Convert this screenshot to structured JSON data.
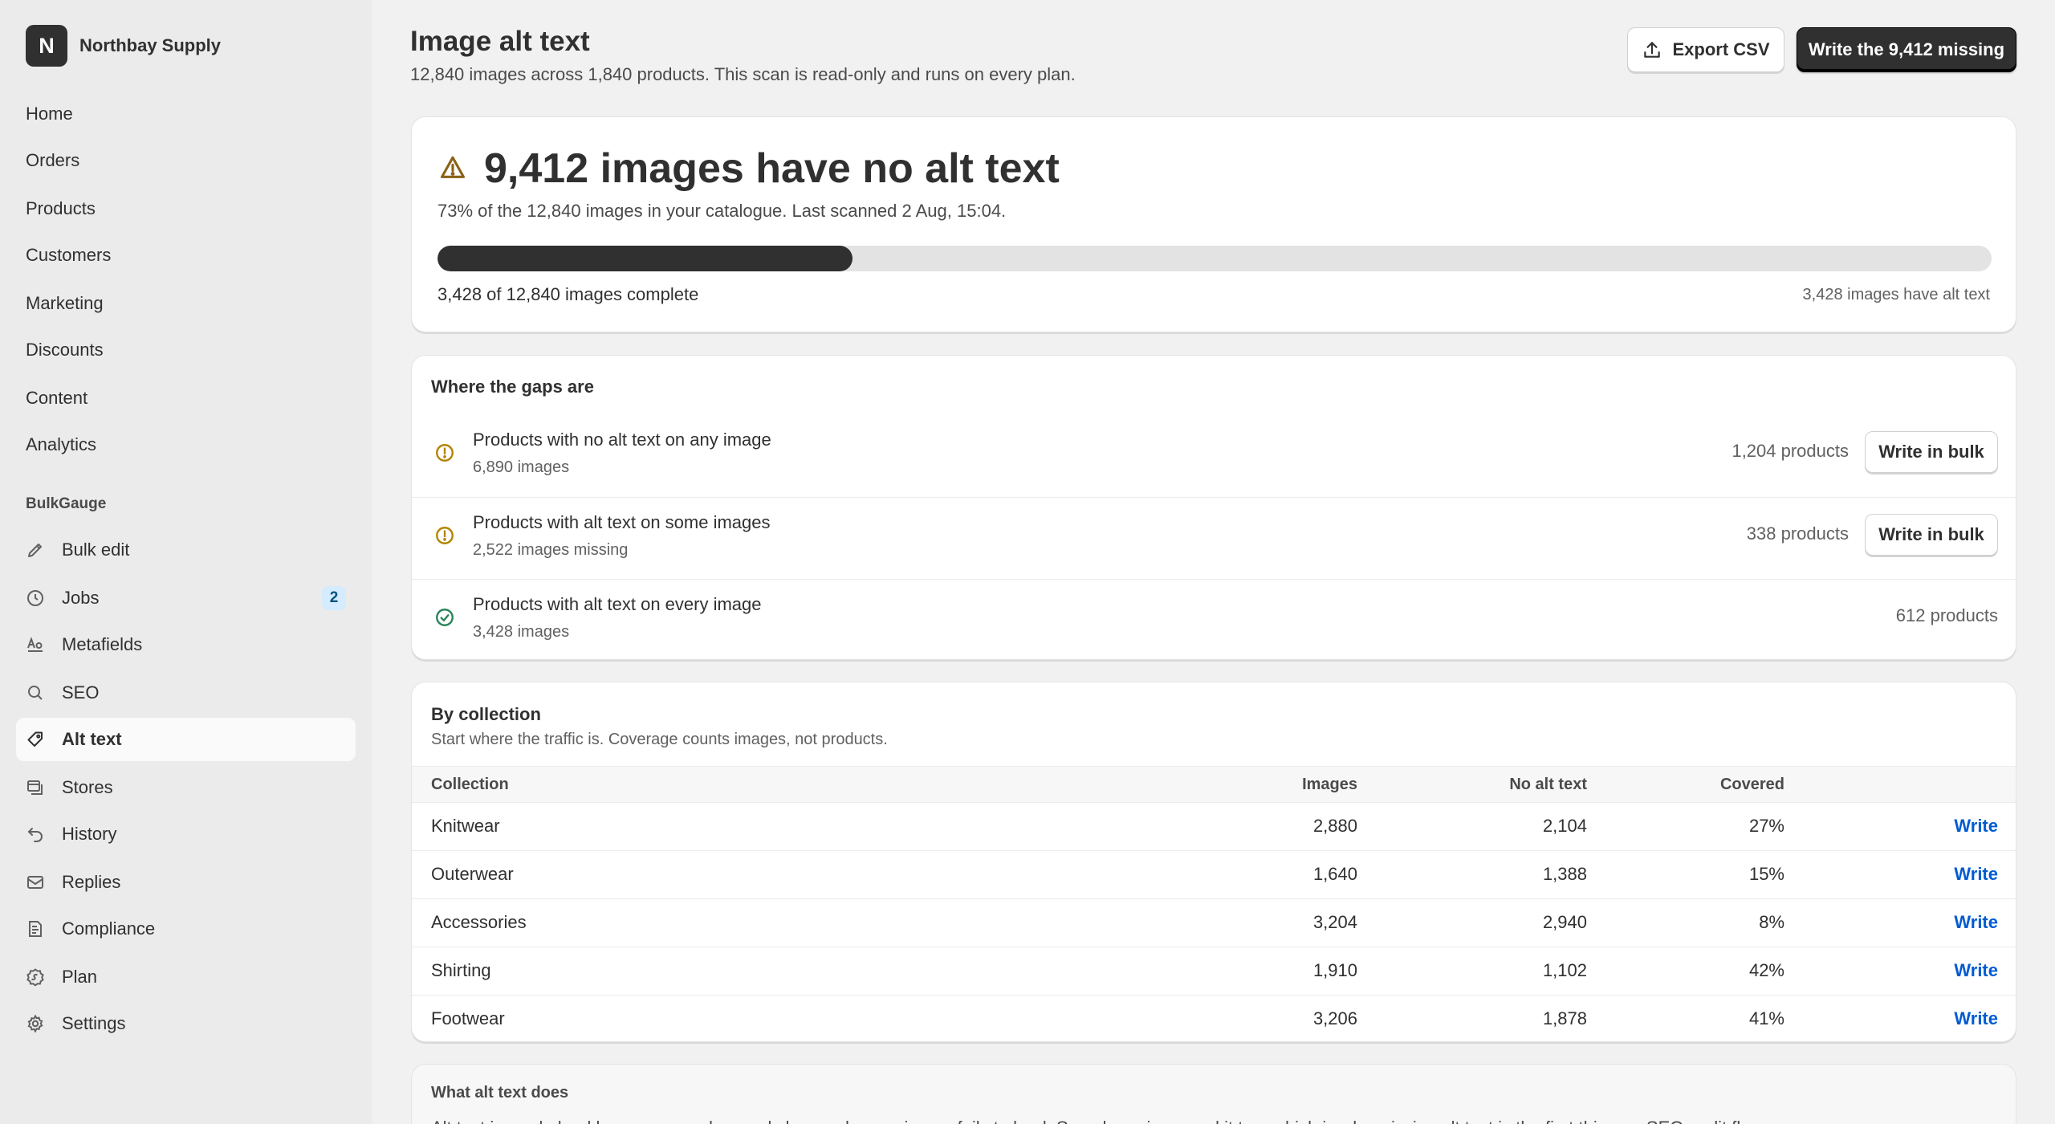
{
  "brand": {
    "initial": "N",
    "name": "Northbay Supply"
  },
  "nav": {
    "main": [
      {
        "label": "Home"
      },
      {
        "label": "Orders"
      },
      {
        "label": "Products"
      },
      {
        "label": "Customers"
      },
      {
        "label": "Marketing"
      },
      {
        "label": "Discounts"
      },
      {
        "label": "Content"
      },
      {
        "label": "Analytics"
      }
    ],
    "section_label": "BulkGauge",
    "app": [
      {
        "label": "Bulk edit",
        "icon": "pencil-icon"
      },
      {
        "label": "Jobs",
        "icon": "clock-icon",
        "badge": "2"
      },
      {
        "label": "Metafields",
        "icon": "metafields-icon"
      },
      {
        "label": "SEO",
        "icon": "search-icon"
      },
      {
        "label": "Alt text",
        "icon": "tag-icon",
        "active": true
      },
      {
        "label": "Stores",
        "icon": "stores-icon"
      },
      {
        "label": "History",
        "icon": "undo-icon"
      },
      {
        "label": "Replies",
        "icon": "mail-icon"
      },
      {
        "label": "Compliance",
        "icon": "document-icon"
      },
      {
        "label": "Plan",
        "icon": "plan-icon"
      },
      {
        "label": "Settings",
        "icon": "gear-icon"
      }
    ]
  },
  "header": {
    "title": "Image alt text",
    "subtitle": "12,840 images across 1,840 products. This scan is read-only and runs on every plan.",
    "export_label": "Export CSV",
    "primary_label": "Write the 9,412 missing"
  },
  "summary": {
    "title": "9,412 images have no alt text",
    "subtitle": "73% of the 12,840 images in your catalogue. Last scanned 2 Aug, 15:04.",
    "progress_fraction": 0.267,
    "progress_label": "3,428 of 12,840 images complete",
    "progress_right": "3,428 images have alt text",
    "warning_color": "#8a6116",
    "bar_color": "#303030"
  },
  "gaps": {
    "heading": "Where the gaps are",
    "rows": [
      {
        "title": "Products with no alt text on any image",
        "sub": "6,890 images",
        "count": "1,204 products",
        "action": "Write in bulk",
        "icon": "warning-circle-icon"
      },
      {
        "title": "Products with alt text on some images",
        "sub": "2,522 images missing",
        "count": "338 products",
        "action": "Write in bulk",
        "icon": "warning-circle-icon"
      },
      {
        "title": "Products with alt text on every image",
        "sub": "3,428 images",
        "count": "612 products",
        "icon": "check-circle-icon"
      }
    ],
    "warning_color": "#b28400",
    "success_color": "#29845a"
  },
  "collections": {
    "heading": "By collection",
    "description": "Start where the traffic is. Coverage counts images, not products.",
    "columns": [
      "Collection",
      "Images",
      "No alt text",
      "Covered"
    ],
    "rows": [
      {
        "name": "Knitwear",
        "images": "2,880",
        "missing": "2,104",
        "covered": "27%",
        "action": "Write"
      },
      {
        "name": "Outerwear",
        "images": "1,640",
        "missing": "1,388",
        "covered": "15%",
        "action": "Write"
      },
      {
        "name": "Accessories",
        "images": "3,204",
        "missing": "2,940",
        "covered": "8%",
        "action": "Write"
      },
      {
        "name": "Shirting",
        "images": "1,910",
        "missing": "1,102",
        "covered": "42%",
        "action": "Write"
      },
      {
        "name": "Footwear",
        "images": "3,206",
        "missing": "1,878",
        "covered": "41%",
        "action": "Write"
      }
    ],
    "link_color": "#005bd3"
  },
  "info": {
    "title": "What alt text does",
    "text": "Alt text is read aloud by screen readers and shown when an image fails to load. Search engines read it too, which is why missing alt text is the first thing an SEO audit flags."
  }
}
